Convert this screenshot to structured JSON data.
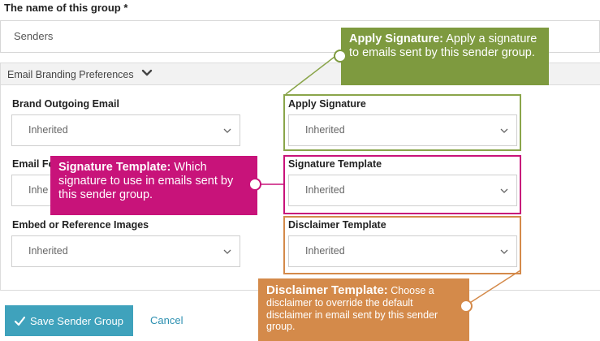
{
  "form": {
    "group_name_label": "The name of this group *",
    "group_name_value": "Senders"
  },
  "panel": {
    "title": "Email Branding Preferences",
    "fields": [
      {
        "label": "Brand Outgoing Email",
        "value": "Inherited"
      },
      {
        "label": "Email Fo",
        "value": "Inhe"
      },
      {
        "label": "Embed or Reference Images",
        "value": "Inherited"
      },
      {
        "label": "Apply Signature",
        "value": "Inherited"
      },
      {
        "label": "Signature Template",
        "value": "Inherited"
      },
      {
        "label": "Disclaimer Template",
        "value": "Inherited"
      }
    ]
  },
  "callouts": {
    "apply_signature": {
      "title": "Apply Signature:",
      "text": " Apply a signature to emails sent by this sender group.",
      "color": "#7e9a3f"
    },
    "signature_template": {
      "title": "Signature Template:",
      "text": " Which signature to use in emails sent by this sender group.",
      "color": "#c8137a"
    },
    "disclaimer_template": {
      "title": "Disclaimer Template:",
      "text": " Choose a disclaimer to override the default disclaimer in email sent by this sender group.",
      "color": "#d48a4a"
    }
  },
  "actions": {
    "save_label": "Save Sender Group",
    "cancel_label": "Cancel"
  },
  "colors": {
    "accent": "#3fa2bc",
    "apply_signature": "#7e9a3f",
    "signature_template": "#c8137a",
    "disclaimer_template": "#d48a4a"
  }
}
